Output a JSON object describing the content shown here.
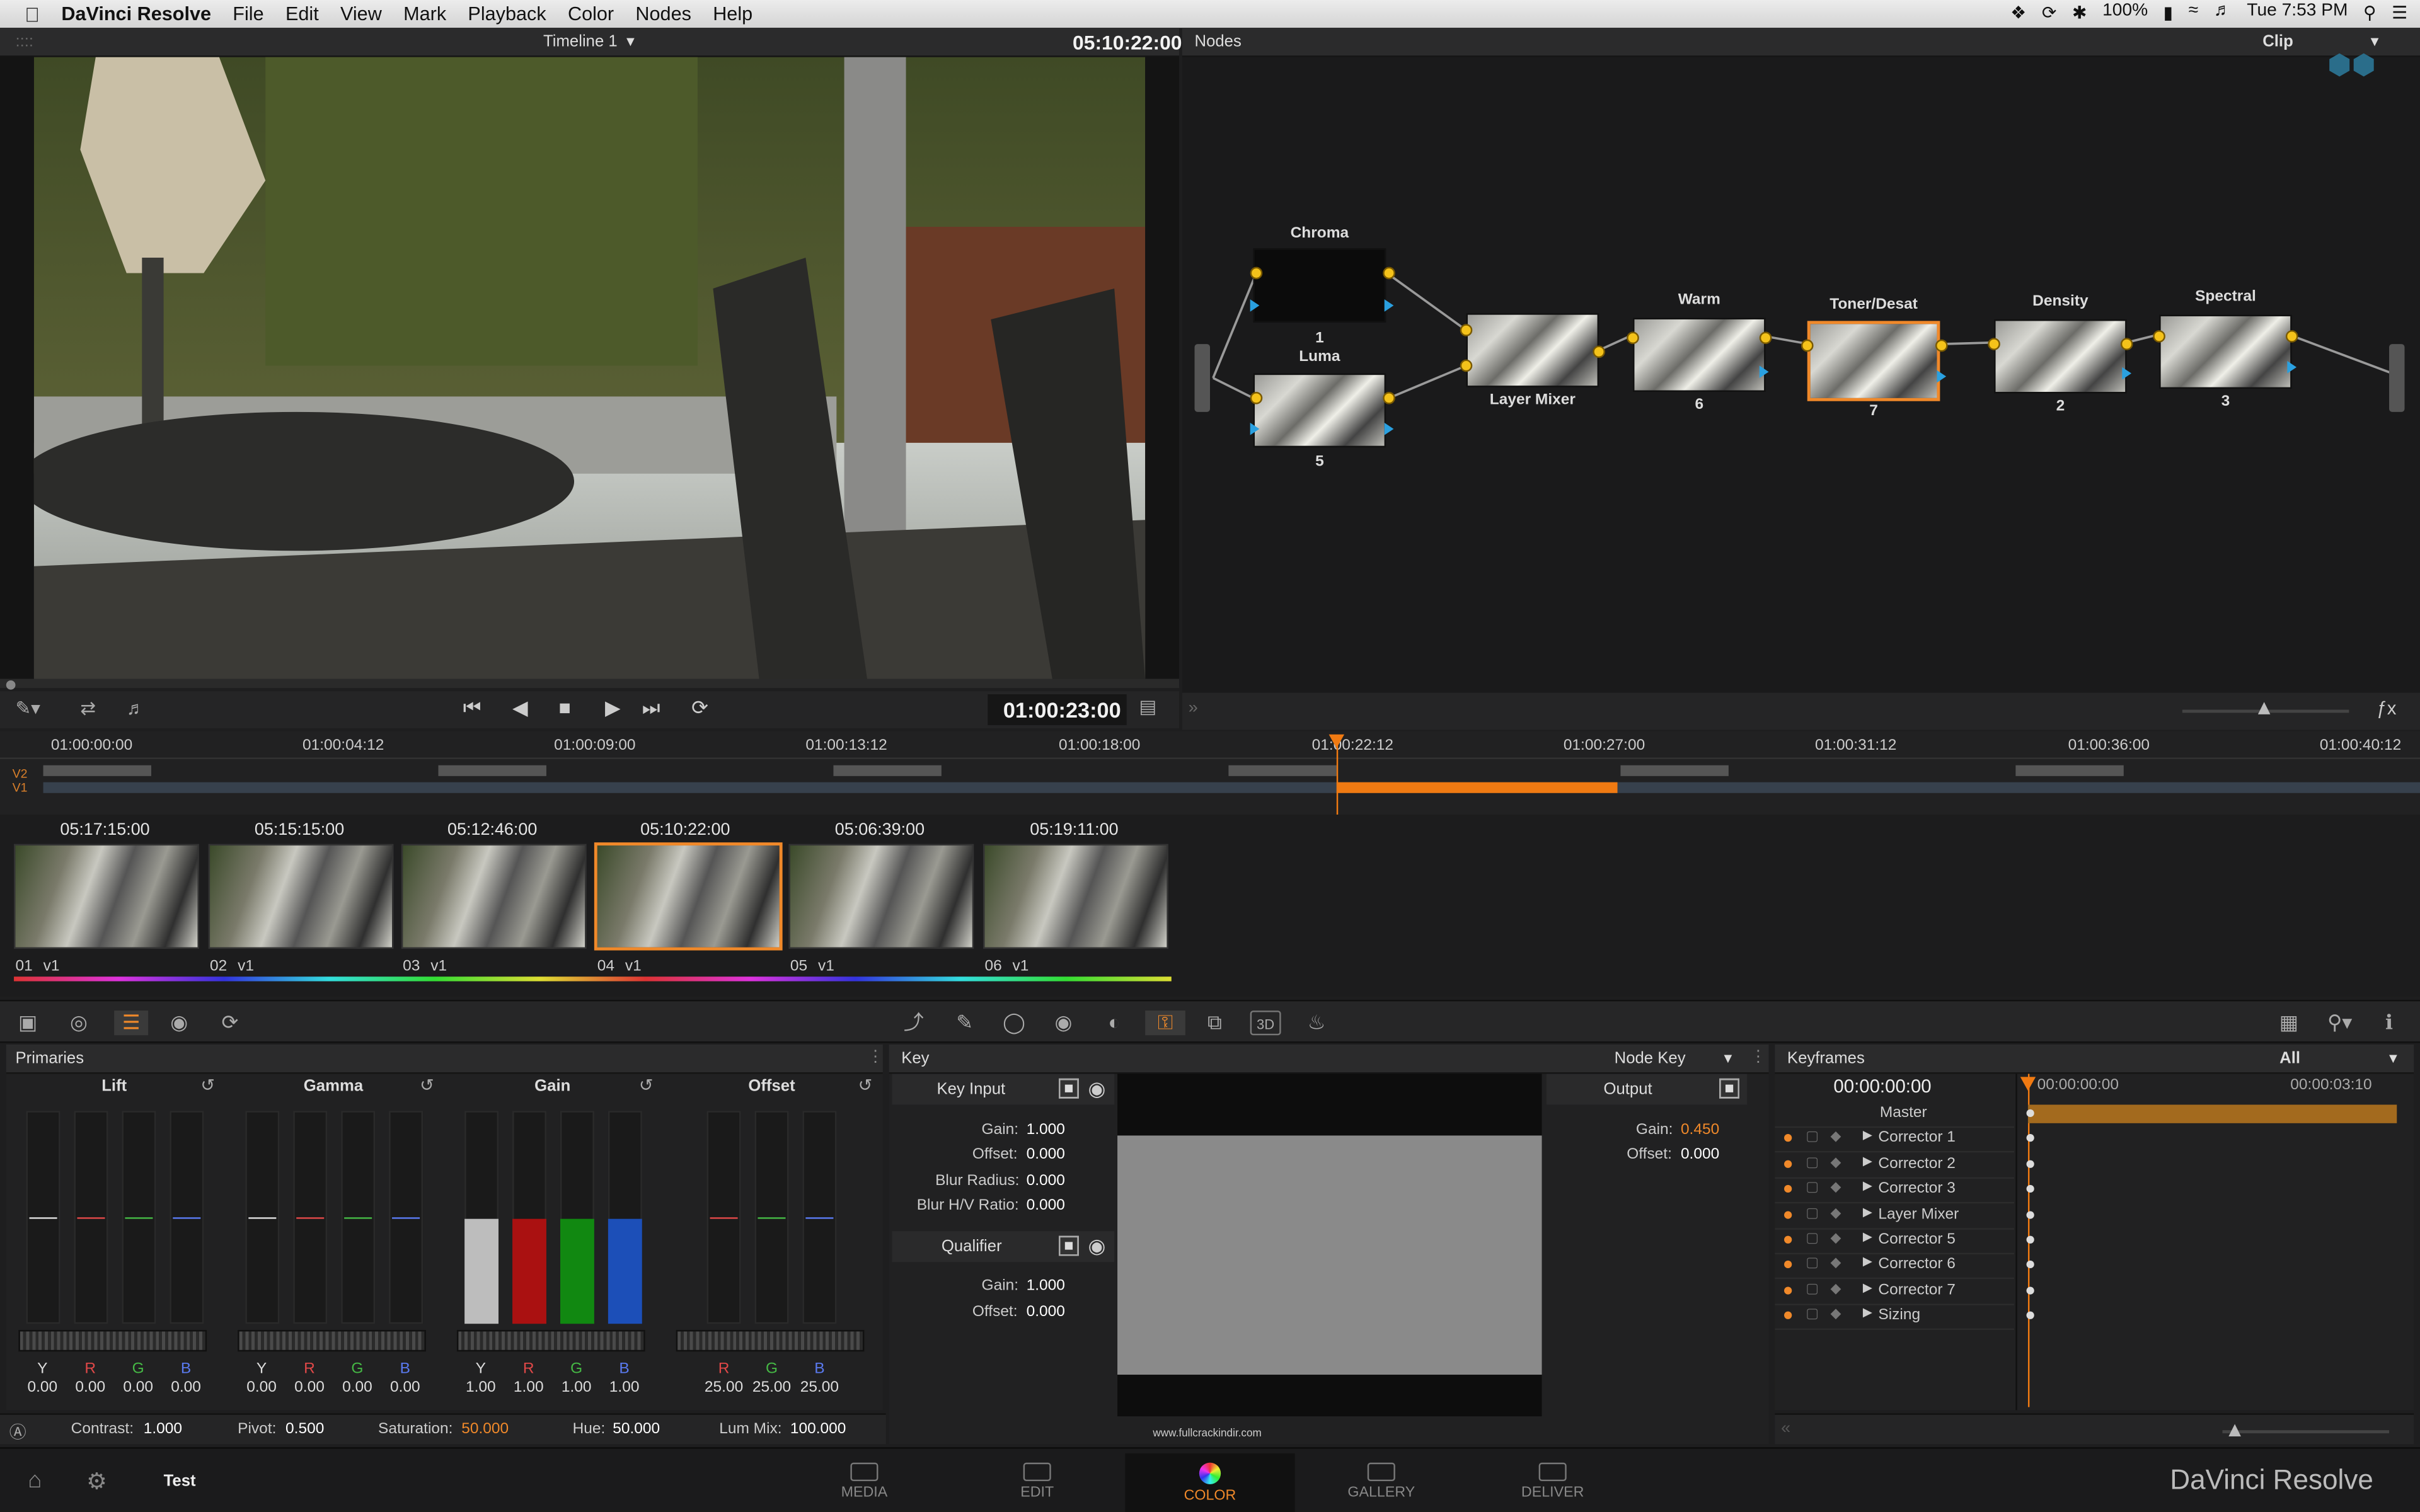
{
  "menubar": {
    "app": "DaVinci Resolve",
    "items": [
      "File",
      "Edit",
      "View",
      "Mark",
      "Playback",
      "Color",
      "Nodes",
      "Help"
    ],
    "battery": "100%",
    "clock": "Tue 7:53 PM"
  },
  "viewer": {
    "timeline_name": "Timeline 1",
    "source_tc": "05:10:22:00",
    "record_tc": "01:00:23:00"
  },
  "nodes": {
    "title": "Nodes",
    "mode": "Clip",
    "list": [
      {
        "label": "Chroma",
        "num": "1"
      },
      {
        "label": "Luma",
        "num": "5"
      },
      {
        "label": "Layer Mixer",
        "num": ""
      },
      {
        "label": "Warm",
        "num": "6"
      },
      {
        "label": "Toner/Desat",
        "num": "7"
      },
      {
        "label": "Density",
        "num": "2"
      },
      {
        "label": "Spectral",
        "num": "3"
      }
    ]
  },
  "timeline": {
    "ruler": [
      "01:00:00:00",
      "01:00:04:12",
      "01:00:09:00",
      "01:00:13:12",
      "01:00:18:00",
      "01:00:22:12",
      "01:00:27:00",
      "01:00:31:12",
      "01:00:36:00",
      "01:00:40:12"
    ],
    "tracks": [
      "V2",
      "V1"
    ]
  },
  "clips": [
    {
      "tc": "05:17:15:00",
      "num": "01",
      "track": "v1"
    },
    {
      "tc": "05:15:15:00",
      "num": "02",
      "track": "v1"
    },
    {
      "tc": "05:12:46:00",
      "num": "03",
      "track": "v1"
    },
    {
      "tc": "05:10:22:00",
      "num": "04",
      "track": "v1"
    },
    {
      "tc": "05:06:39:00",
      "num": "05",
      "track": "v1"
    },
    {
      "tc": "05:19:11:00",
      "num": "06",
      "track": "v1"
    }
  ],
  "primaries": {
    "title": "Primaries",
    "wheels": [
      {
        "name": "Lift",
        "labels": [
          "Y",
          "R",
          "G",
          "B"
        ],
        "values": [
          "0.00",
          "0.00",
          "0.00",
          "0.00"
        ]
      },
      {
        "name": "Gamma",
        "labels": [
          "Y",
          "R",
          "G",
          "B"
        ],
        "values": [
          "0.00",
          "0.00",
          "0.00",
          "0.00"
        ]
      },
      {
        "name": "Gain",
        "labels": [
          "Y",
          "R",
          "G",
          "B"
        ],
        "values": [
          "1.00",
          "1.00",
          "1.00",
          "1.00"
        ]
      },
      {
        "name": "Offset",
        "labels": [
          "R",
          "G",
          "B"
        ],
        "values": [
          "25.00",
          "25.00",
          "25.00"
        ]
      }
    ],
    "contrast_label": "Contrast:",
    "contrast": "1.000",
    "pivot_label": "Pivot:",
    "pivot": "0.500",
    "saturation_label": "Saturation:",
    "saturation": "50.000",
    "hue_label": "Hue:",
    "hue": "50.000",
    "lummix_label": "Lum Mix:",
    "lummix": "100.000"
  },
  "key": {
    "title": "Key",
    "mode": "Node Key",
    "key_input": "Key Input",
    "output": "Output",
    "qualifier": "Qualifier",
    "gain_label": "Gain:",
    "gain": "1.000",
    "offset_label": "Offset:",
    "offset": "0.000",
    "blur_radius_label": "Blur Radius:",
    "blur_radius": "0.000",
    "blur_hv_label": "Blur H/V Ratio:",
    "blur_hv": "0.000",
    "out_gain_label": "Gain:",
    "out_gain": "0.450",
    "out_offset_label": "Offset:",
    "out_offset": "0.000",
    "q_gain_label": "Gain:",
    "q_gain": "1.000",
    "q_offset_label": "Offset:",
    "q_offset": "0.000",
    "watermark": "www.fullcrackindir.com"
  },
  "keyframes": {
    "title": "Keyframes",
    "filter": "All",
    "tc": "00:00:00:00",
    "ruler": [
      "00:00:00:00",
      "00:00:03:10"
    ],
    "rows": [
      "Master",
      "Corrector 1",
      "Corrector 2",
      "Corrector 3",
      "Layer Mixer",
      "Corrector 5",
      "Corrector 6",
      "Corrector 7",
      "Sizing"
    ]
  },
  "bottombar": {
    "project": "Test",
    "tabs": [
      "MEDIA",
      "EDIT",
      "COLOR",
      "GALLERY",
      "DELIVER"
    ],
    "brand": "DaVinci Resolve"
  },
  "colors": {
    "accent": "#f0892a",
    "node_dot": "#f4c21a",
    "input_arrow": "#2aa0e0"
  }
}
